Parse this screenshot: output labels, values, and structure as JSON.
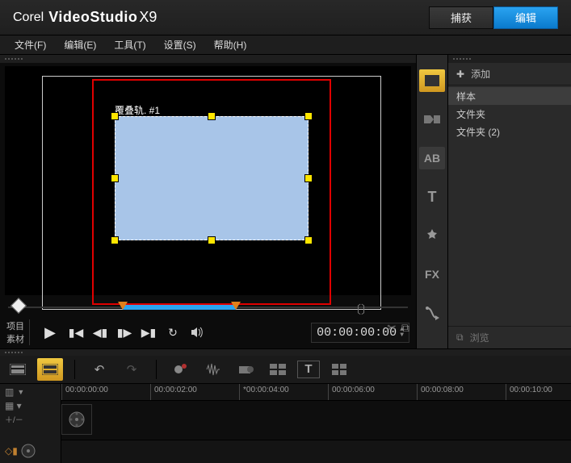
{
  "brand": {
    "corel": "Corel",
    "product": "VideoStudio",
    "version": "X9"
  },
  "modes": {
    "capture": "捕获",
    "edit": "编辑"
  },
  "menu": {
    "file": "文件(F)",
    "edit": "编辑(E)",
    "tools": "工具(T)",
    "settings": "设置(S)",
    "help": "帮助(H)"
  },
  "preview": {
    "overlay_label": "覆叠轨. #1"
  },
  "controls": {
    "project": "项目",
    "clip": "素材",
    "timecode": "00:00:00:00"
  },
  "library": {
    "add": "添加",
    "items": [
      "样本",
      "文件夹",
      "文件夹 (2)"
    ],
    "browse": "浏览"
  },
  "timeline": {
    "ticks": [
      "00:00:00:00",
      "00:00:02:00",
      "*00:00:04:00",
      "00:00:06:00",
      "00:00:08:00",
      "00:00:10:00"
    ]
  }
}
